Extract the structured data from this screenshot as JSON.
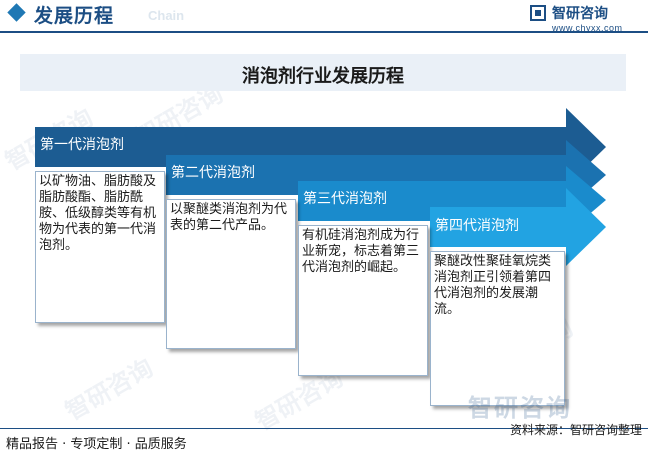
{
  "header": {
    "title": "发展历程",
    "subtitle_en": "Chain"
  },
  "brand": {
    "name": "智研咨询",
    "url": "www.chyxx.com"
  },
  "diagram_title": "消泡剂行业发展历程",
  "generations": [
    {
      "label": "第一代消泡剂",
      "text": "以矿物油、脂肪酸及脂肪酸酯、脂肪酰胺、低级醇类等有机物为代表的第一代消泡剂。",
      "color": "#1c5c92"
    },
    {
      "label": "第二代消泡剂",
      "text": "以聚醚类消泡剂为代表的第二代产品。",
      "color": "#1b72b0"
    },
    {
      "label": "第三代消泡剂",
      "text": "有机硅消泡剂成为行业新宠，标志着第三代消泡剂的崛起。",
      "color": "#1a8bcc"
    },
    {
      "label": "第四代消泡剂",
      "text": "聚醚改性聚硅氧烷类消泡剂正引领着第四代消泡剂的发展潮流。",
      "color": "#22a3e2"
    }
  ],
  "watermark": "智研咨询",
  "footer": {
    "left": "精品报告 · 专项定制 · 品质服务",
    "source": "资料来源：智研咨询整理"
  }
}
